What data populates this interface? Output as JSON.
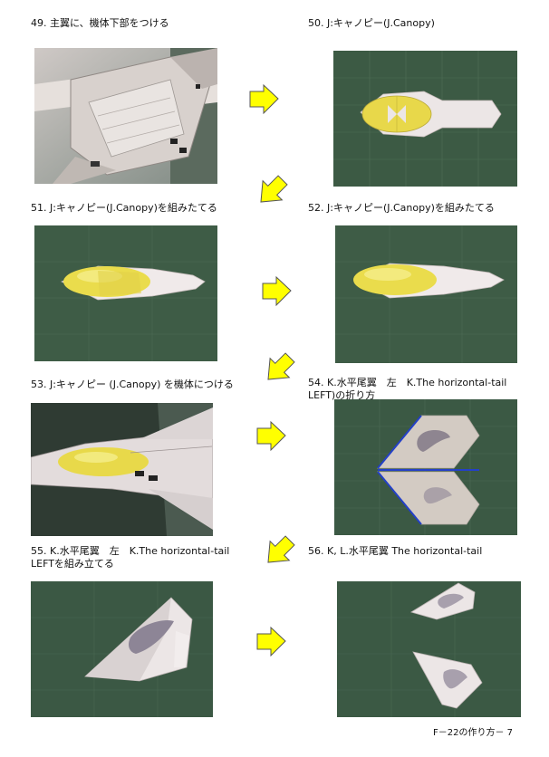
{
  "steps": [
    {
      "caption": "49. 主翼に、機体下部をつける"
    },
    {
      "caption": "50. J:キャノピー(J.Canopy)"
    },
    {
      "caption": "51. J:キャノピー(J.Canopy)を組みたてる"
    },
    {
      "caption": "52. J:キャノピー(J.Canopy)を組みたてる"
    },
    {
      "caption": "53. J:キャノピー (J.Canopy) を機体につける"
    },
    {
      "caption": "54. K.水平尾翼　左　K.The  horizontal-tail LEFT)の折り方"
    },
    {
      "caption": "55. K.水平尾翼　左　K.The  horizontal-tail LEFTを組み立てる"
    },
    {
      "caption": "56. K, L.水平尾翼 The horizontal-tail"
    }
  ],
  "footer": "F－22の作り方－ 7",
  "colors": {
    "arrow_fill": "#ffff00",
    "mat_green": "#3c5a44",
    "canopy_yellow": "#e8d84a",
    "paper": "#ece6e6"
  }
}
